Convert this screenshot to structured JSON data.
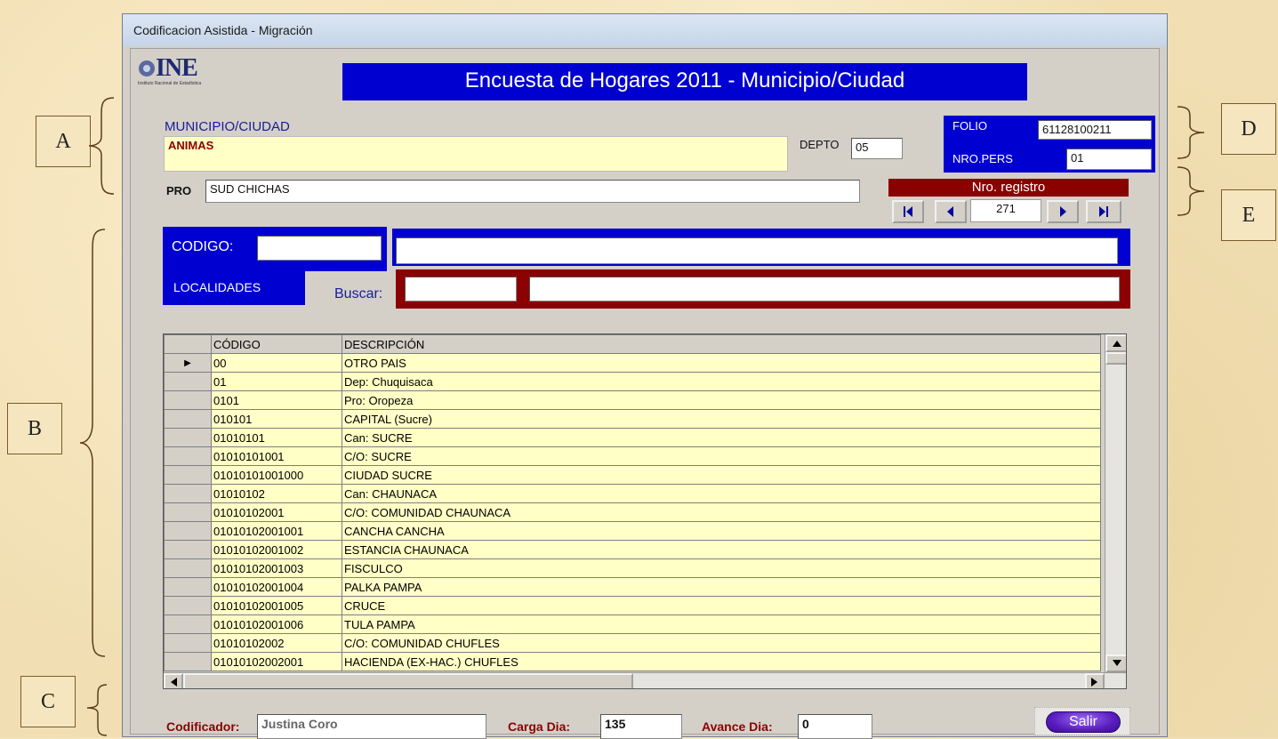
{
  "window": {
    "title": "Codificacion Asistida - Migración"
  },
  "logo": {
    "text": "INE",
    "subtext": "Instituto Nacional de Estadística"
  },
  "banner": {
    "title": "Encuesta de Hogares 2011 - Municipio/Ciudad"
  },
  "callouts": {
    "a": "A",
    "b": "B",
    "c": "C",
    "d": "D",
    "e": "E"
  },
  "municipio": {
    "label": "MUNICIPIO/CIUDAD",
    "value": "ANIMAS"
  },
  "depto": {
    "label": "DEPTO",
    "value": "05"
  },
  "pro": {
    "label": "PRO",
    "value": "SUD CHICHAS"
  },
  "folio": {
    "label": "FOLIO",
    "value": "61128100211"
  },
  "nropers": {
    "label": "NRO.PERS",
    "value": "01"
  },
  "registro": {
    "label": "Nro. registro",
    "value": "271",
    "first_icon": "first-record-icon",
    "prev_icon": "prev-record-icon",
    "next_icon": "next-record-icon",
    "last_icon": "last-record-icon"
  },
  "codigo": {
    "label": "CODIGO:",
    "value": "",
    "description": ""
  },
  "localidades": {
    "label": "LOCALIDADES"
  },
  "buscar": {
    "label": "Buscar:",
    "code": "",
    "text": ""
  },
  "grid": {
    "columns": [
      "CÓDIGO",
      "DESCRIPCIÓN"
    ],
    "current_row_marker": "▶",
    "rows": [
      {
        "codigo": "00",
        "descripcion": "OTRO PAIS"
      },
      {
        "codigo": "01",
        "descripcion": "Dep: Chuquisaca"
      },
      {
        "codigo": "0101",
        "descripcion": "Pro: Oropeza"
      },
      {
        "codigo": "010101",
        "descripcion": "CAPITAL (Sucre)"
      },
      {
        "codigo": "01010101",
        "descripcion": "Can: SUCRE"
      },
      {
        "codigo": "01010101001",
        "descripcion": "C/O: SUCRE"
      },
      {
        "codigo": "01010101001000",
        "descripcion": "CIUDAD SUCRE"
      },
      {
        "codigo": "01010102",
        "descripcion": "Can: CHAUNACA"
      },
      {
        "codigo": "01010102001",
        "descripcion": "C/O: COMUNIDAD CHAUNACA"
      },
      {
        "codigo": "01010102001001",
        "descripcion": "CANCHA CANCHA"
      },
      {
        "codigo": "01010102001002",
        "descripcion": "ESTANCIA CHAUNACA"
      },
      {
        "codigo": "01010102001003",
        "descripcion": "FISCULCO"
      },
      {
        "codigo": "01010102001004",
        "descripcion": "PALKA PAMPA"
      },
      {
        "codigo": "01010102001005",
        "descripcion": "CRUCE"
      },
      {
        "codigo": "01010102001006",
        "descripcion": "TULA PAMPA"
      },
      {
        "codigo": "01010102002",
        "descripcion": "C/O: COMUNIDAD CHUFLES"
      },
      {
        "codigo": "01010102002001",
        "descripcion": "HACIENDA (EX-HAC.) CHUFLES"
      }
    ]
  },
  "footer": {
    "codificador_label": "Codificador:",
    "codificador_value": "Justina Coro",
    "carga_label": "Carga Dia:",
    "carga_value": "135",
    "avance_label": "Avance Dia:",
    "avance_value": "0",
    "salir_label": "Salir"
  }
}
